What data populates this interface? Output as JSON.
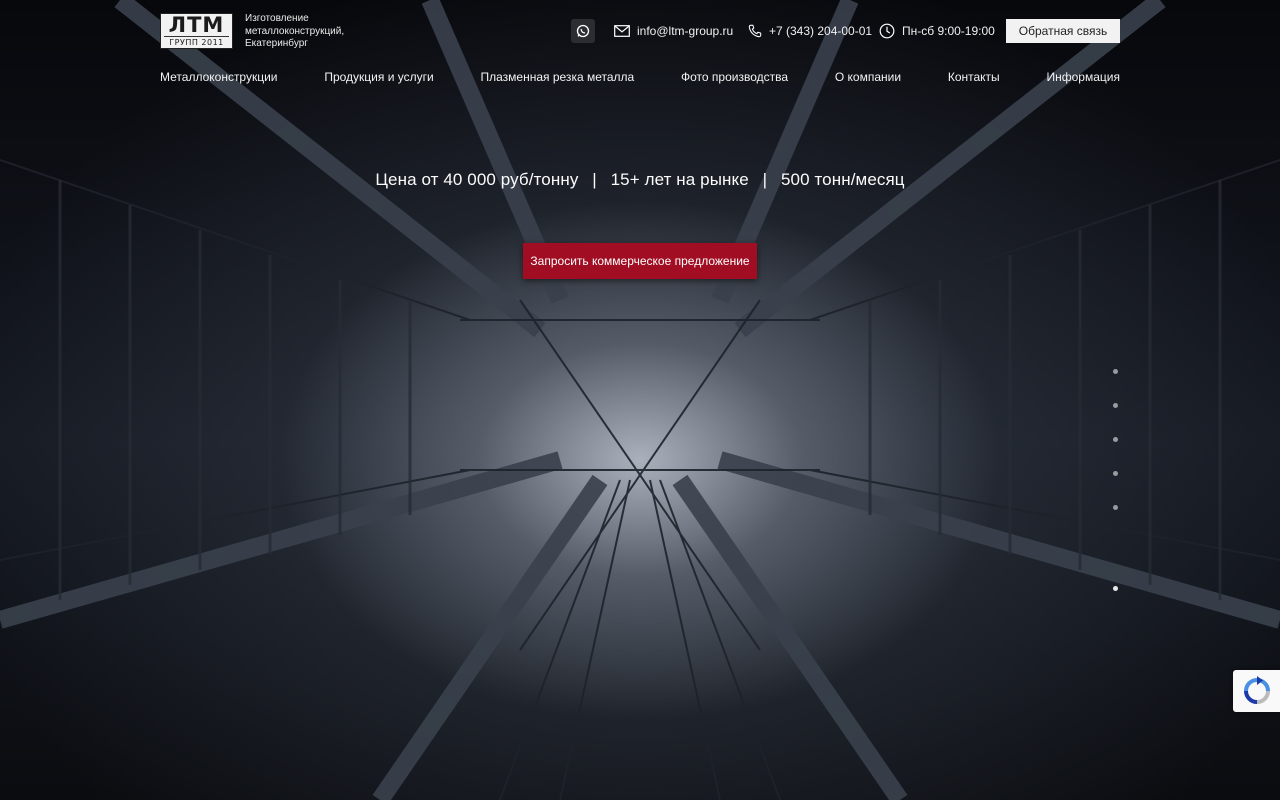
{
  "logo": {
    "main": "ЛТМ",
    "sub": "ГРУПП 2011"
  },
  "tagline": [
    "Изготовление",
    "металлоконструкций,",
    "Екатеринбург"
  ],
  "contacts": {
    "email": "info@ltm-group.ru",
    "phone": "+7 (343) 204-00-01",
    "hours": "Пн-сб 9:00-19:00"
  },
  "callback_label": "Обратная связь",
  "nav": [
    "Металлоконструкции",
    "Продукция и услуги",
    "Плазменная резка металла",
    "Фото производства",
    "О компании",
    "Контакты",
    "Информация"
  ],
  "stats": [
    "Цена от 40 000 руб/тонну",
    "15+ лет на рынке",
    "500 тонн/месяц"
  ],
  "stats_separator": "|",
  "cta_label": "Запросить коммерческое предложение",
  "slider": {
    "count": 6,
    "active": 5
  },
  "icons": [
    "whatsapp-icon",
    "mail-icon",
    "phone-icon",
    "clock-icon",
    "recaptcha-icon"
  ],
  "colors": {
    "cta": "#a10d23",
    "background": "#0b0d12",
    "button_light": "#f2f2f2"
  }
}
